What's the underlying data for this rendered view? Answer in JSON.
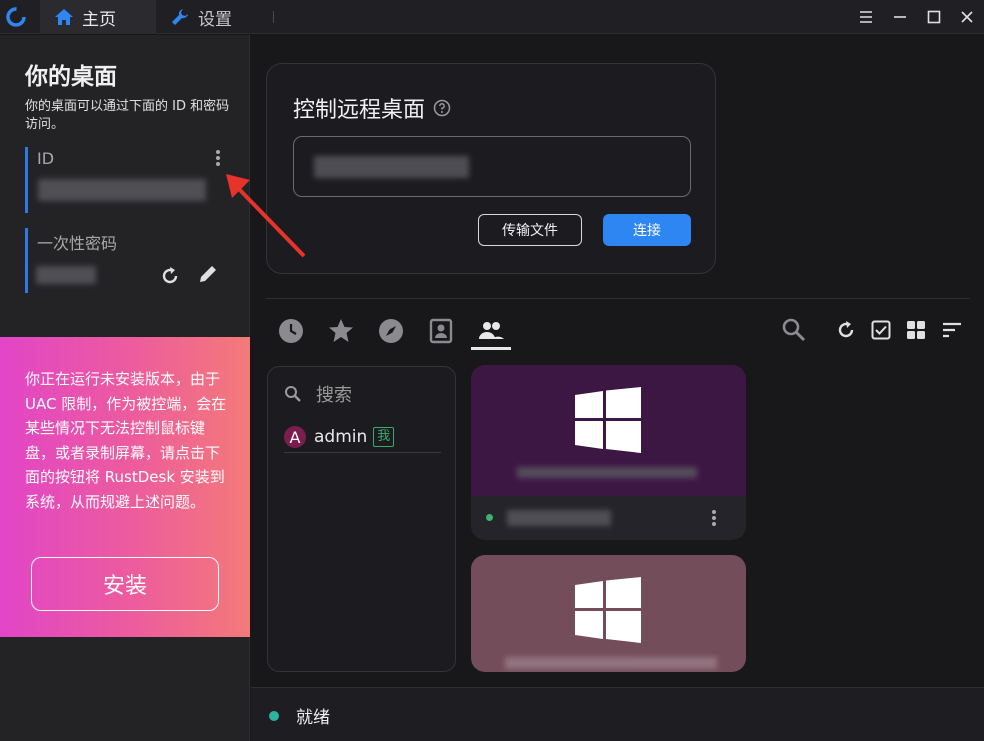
{
  "titlebar": {
    "tabs": [
      {
        "label": "主页",
        "icon": "home-icon"
      },
      {
        "label": "设置",
        "icon": "wrench-icon"
      }
    ],
    "window_buttons": [
      "menu-icon",
      "minimize-icon",
      "maximize-icon",
      "close-icon"
    ]
  },
  "left": {
    "title": "你的桌面",
    "description": "你的桌面可以通过下面的 ID 和密码访问。",
    "id_label": "ID",
    "password_label": "一次性密码",
    "banner_text": "你正在运行未安装版本，由于 UAC 限制，作为被控端，会在某些情况下无法控制鼠标键盘，或者录制屏幕，请点击下面的按钮将 RustDesk 安装到系统，从而规避上述问题。",
    "install_label": "安装"
  },
  "remote": {
    "title": "控制远程桌面",
    "transfer_label": "传输文件",
    "connect_label": "连接"
  },
  "peers": {
    "tabs": [
      "recent-icon",
      "favorites-icon",
      "discovered-icon",
      "address-book-icon",
      "group-icon"
    ],
    "actions": [
      "search-icon",
      "refresh-icon",
      "select-icon",
      "grid-view-icon",
      "sort-icon"
    ],
    "search_placeholder": "搜索",
    "user": {
      "avatar_letter": "A",
      "name": "admin",
      "badge": "我"
    }
  },
  "status": {
    "text": "就绪"
  },
  "colors": {
    "accent": "#2e86f3",
    "online": "#3cb371",
    "ready": "#2bb5a0"
  }
}
